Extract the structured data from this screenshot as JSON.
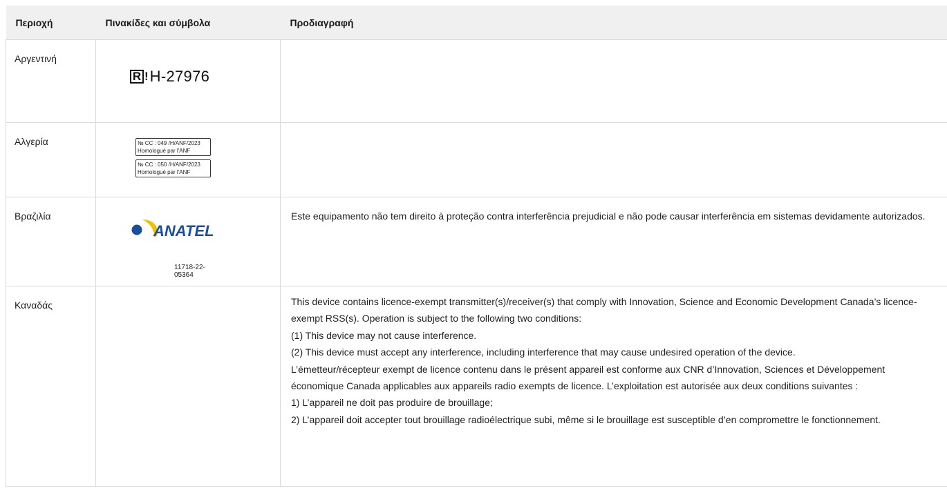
{
  "table": {
    "headers": [
      "Περιοχή",
      "Πινακίδες και σύμβολα",
      "Προδιαγραφή"
    ],
    "rows": [
      {
        "region": "Αργεντινή",
        "symbol_code": "H-27976",
        "spec": ""
      },
      {
        "region": "Αλγερία",
        "labels": [
          {
            "line1": "№ CC : 049 /H/ANF/2023",
            "line2": "Homologué par l'ANF"
          },
          {
            "line1": "№ CC : 050 /H/ANF/2023",
            "line2": "Homologué par l'ANF"
          }
        ],
        "spec": ""
      },
      {
        "region": "Βραζιλία",
        "logo_text": "ANATEL",
        "logo_code": "11718-22-05364",
        "spec": "Este equipamento não tem direito à proteção contra interferência prejudicial e não pode causar interferência em sistemas devidamente autorizados."
      },
      {
        "region": "Καναδάς",
        "spec_lines": [
          "This device contains licence-exempt transmitter(s)/receiver(s) that comply with Innovation, Science and Economic Development Canada’s licence-exempt RSS(s). Operation is subject to the following two conditions:",
          "(1) This device may not cause interference.",
          "(2) This device must accept any interference, including interference that may cause undesired operation of the device.",
          "L’émetteur/récepteur exempt de licence contenu dans le présent appareil est conforme aux CNR d’Innovation, Sciences et Développement économique Canada applicables aux appareils radio exempts de licence. L’exploitation est autorisée aux deux conditions suivantes :",
          "1) L’appareil ne doit pas produire de brouillage;",
          "2) L’appareil doit accepter tout brouillage radioélectrique subi, même si le brouillage est susceptible d’en compromettre le fonctionnement."
        ]
      }
    ]
  },
  "colors": {
    "header_bg": "#f0f0f0",
    "border": "#d9d9d9",
    "anatel_blue": "#1a4fa0",
    "anatel_yellow": "#f2c200"
  }
}
